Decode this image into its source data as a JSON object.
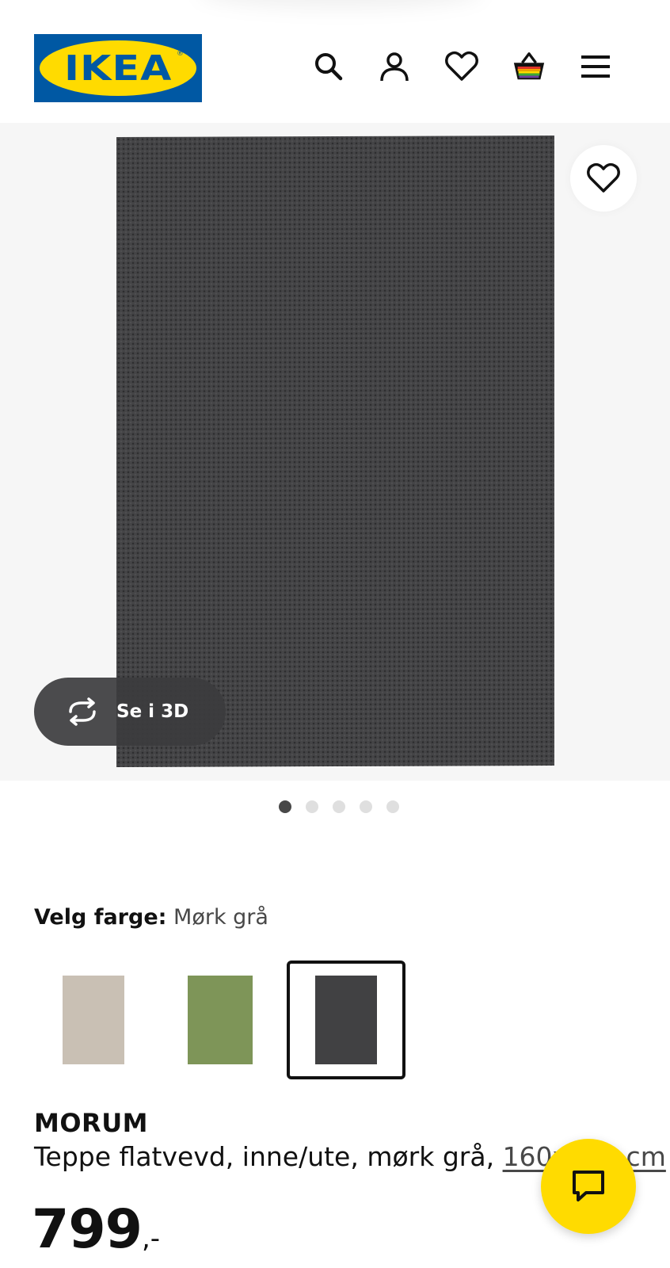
{
  "header": {
    "logo_text": "IKEA",
    "logo_reg": "®",
    "icons": [
      "search-icon",
      "account-icon",
      "favourites-icon",
      "basket-icon",
      "menu-icon"
    ]
  },
  "gallery": {
    "view3d_label": "Se i 3D",
    "image_count": 5,
    "active_index": 0
  },
  "color_selector": {
    "label": "Velg farge:",
    "value": "Mørk grå",
    "swatches": [
      {
        "color": "#c9c0b4",
        "selected": false
      },
      {
        "color": "#7e9558",
        "selected": false
      },
      {
        "color": "#414143",
        "selected": true
      }
    ]
  },
  "product": {
    "name": "MORUM",
    "description": "Teppe flatvevd, inne/ute, mørk grå, ",
    "size_link": "160x230 cm",
    "price_main": "799",
    "price_suffix": ",-"
  },
  "colors": {
    "brand_blue": "#0058a3",
    "brand_yellow": "#ffdb00"
  }
}
